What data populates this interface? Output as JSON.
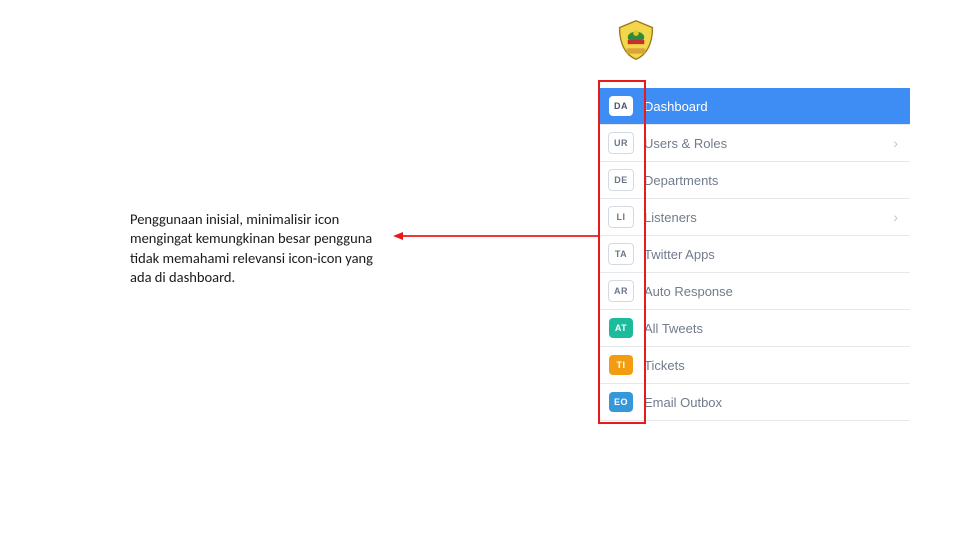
{
  "crest_alt": "Seal of Central Java Province",
  "annotation_text": "Penggunaan inisial, minimalisir icon mengingat kemungkinan besar pengguna tidak memahami relevansi icon-icon yang ada di dashboard.",
  "colors": {
    "active_bg": "#3d8df5",
    "red_outline": "#e81b1b"
  },
  "sidebar": {
    "items": [
      {
        "initials": "DA",
        "label": "Dashboard",
        "chevron": false,
        "active": true,
        "chip": ""
      },
      {
        "initials": "UR",
        "label": "Users & Roles",
        "chevron": true,
        "active": false,
        "chip": ""
      },
      {
        "initials": "DE",
        "label": "Departments",
        "chevron": false,
        "active": false,
        "chip": ""
      },
      {
        "initials": "LI",
        "label": "Listeners",
        "chevron": true,
        "active": false,
        "chip": ""
      },
      {
        "initials": "TA",
        "label": "Twitter Apps",
        "chevron": false,
        "active": false,
        "chip": ""
      },
      {
        "initials": "AR",
        "label": "Auto Response",
        "chevron": false,
        "active": false,
        "chip": ""
      },
      {
        "initials": "AT",
        "label": "All Tweets",
        "chevron": false,
        "active": false,
        "chip": "at"
      },
      {
        "initials": "TI",
        "label": "Tickets",
        "chevron": false,
        "active": false,
        "chip": "ti"
      },
      {
        "initials": "EO",
        "label": "Email Outbox",
        "chevron": false,
        "active": false,
        "chip": "eo"
      }
    ]
  }
}
